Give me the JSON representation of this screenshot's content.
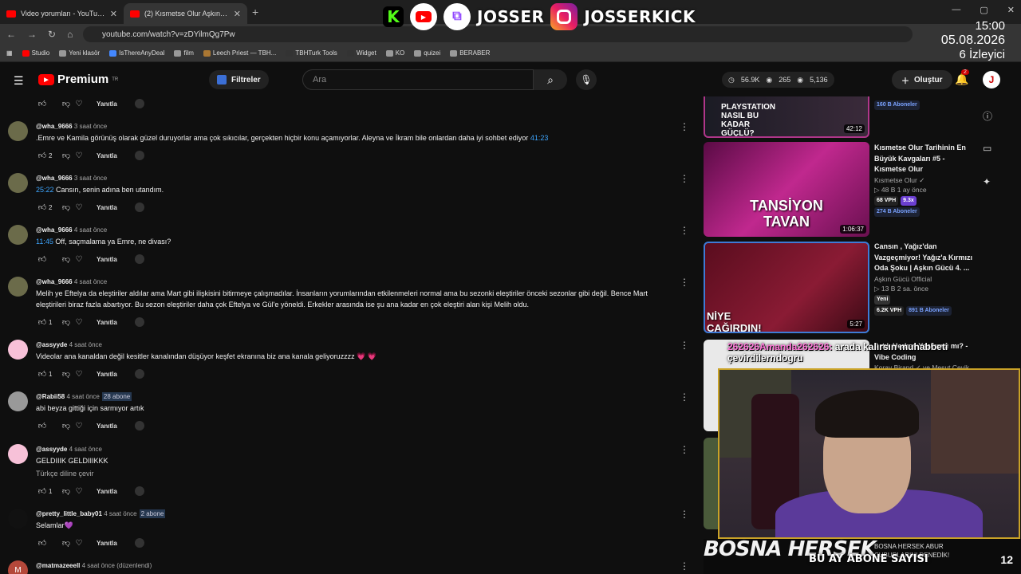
{
  "browser": {
    "tabs": [
      {
        "title": "Video yorumları - YouTube Studio"
      },
      {
        "title": "(2) Kısmetse Olur Aşkın Gücü 5..."
      }
    ],
    "new_tab": "+",
    "url": "youtube.com/watch?v=zDYilmQg7Pw",
    "bookmarks": [
      "Studio",
      "Yeni klasör",
      "IsThereAnyDeal",
      "film",
      "Leech Priest — TBH...",
      "TBHTurk Tools",
      "Widget",
      "KO",
      "quizei",
      "BERABER"
    ]
  },
  "overlay": {
    "brand1": "JOSSER",
    "brand2": "JOSSERKICK",
    "time": "15:00",
    "date": "05.08.2026",
    "viewers": "6 İzleyici",
    "chat_user": "262626Amanda262626:",
    "chat_msg": "arada kalırsın muhabbeti",
    "chat_msg2": "çevirdilerndogru",
    "bottom_big": "BOSNA HERSEK",
    "bottom_label": "BU AY ABONE SAYISI",
    "bottom_num": "12",
    "bottom_small": "BOSNA HERSEK ABUR CUBURLARINI DENEDİK!"
  },
  "youtube": {
    "premium": "Premium",
    "region": "TR",
    "filters": "Filtreler",
    "search_placeholder": "Ara",
    "stats": {
      "a": "56.9K",
      "b": "265",
      "c": "5,136"
    },
    "create": "Oluştur",
    "notif_count": "2",
    "avatar_letter": "J"
  },
  "comments": [
    {
      "user": "",
      "time": "",
      "text": "",
      "likes": "",
      "reply": "Yanıtla"
    },
    {
      "user": "@wha_9666",
      "time": "3 saat önce",
      "text": ".Emre ve Kamila görünüş olarak güzel duruyorlar ama çok sıkıcılar, gerçekten hiçbir konu açamıyorlar. Aleyna ve İkram bile onlardan daha iyi sohbet ediyor",
      "ts": "41:23",
      "likes": "2",
      "reply": "Yanıtla"
    },
    {
      "user": "@wha_9666",
      "time": "3 saat önce",
      "ts": "25:22",
      "text": "Cansın, senin adına ben utandım.",
      "likes": "2",
      "reply": "Yanıtla"
    },
    {
      "user": "@wha_9666",
      "time": "4 saat önce",
      "ts": "11:45",
      "text": "Off, saçmalama ya Emre, ne divası?",
      "likes": "",
      "reply": "Yanıtla"
    },
    {
      "user": "@wha_9666",
      "time": "4 saat önce",
      "text": "Melih ye Eftelya da eleştiriler aldılar ama Mart gibi ilişkisini bitirmeye çalışmadılar. İnsanların yorumlarından etkilenmeleri normal ama bu sezonki eleştiriler önceki sezonlar gibi değil. Bence Mart eleştirileri biraz fazla abartıyor. Bu sezon eleştiriler daha çok Eftelya ve Gül'e yöneldi. Erkekler arasında ise şu ana kadar en çok eleştiri alan kişi Melih oldu.",
      "likes": "1",
      "reply": "Yanıtla"
    },
    {
      "user": "@assyyde",
      "time": "4 saat önce",
      "text": "Videolar ana kanaldan değil kesitler kanalından düşüyor keşfet ekranına biz ana kanala geliyoruzzzz 💗 💗",
      "likes": "1",
      "reply": "Yanıtla"
    },
    {
      "user": "@Rabii58",
      "time": "4 saat önce",
      "badge": "28 abone",
      "text": "abi beyza gittiği için sarmıyor artık",
      "likes": "",
      "reply": "Yanıtla"
    },
    {
      "user": "@assyyde",
      "time": "4 saat önce",
      "text": "GELDIIIK GELDIIIKKK",
      "translate": "Türkçe diline çevir",
      "likes": "1",
      "reply": "Yanıtla"
    },
    {
      "user": "@pretty_little_baby01",
      "time": "4 saat önce",
      "badge": "2 abone",
      "text": "Selamlar💜",
      "likes": "",
      "reply": "Yanıtla"
    },
    {
      "user": "@matmazeeell",
      "time": "4 saat önce (düzenlendi)",
      "text": "",
      "likes": "",
      "reply": ""
    }
  ],
  "sidebar": [
    {
      "title": "",
      "channel": "",
      "meta": "",
      "chip": "160 B Aboneler",
      "thumb_text": "PLAYSTATION NASIL BU KADAR GÜÇLÜ?",
      "duration": "42:12"
    },
    {
      "title": "Kısmetse Olur Tarihinin En Büyük Kavgaları #5 - Kısmetse Olur",
      "channel": "Kısmetse Olur ✓",
      "meta": "▷ 48 B  1 ay önce",
      "vph": "68 VPH",
      "x": "9.3x",
      "chip": "274 B Aboneler",
      "thumb_text": "TANSİYON TAVAN",
      "duration": "1:06:37"
    },
    {
      "title": "Cansın , Yağız'dan Vazgeçmiyor! Yağız'a Kırmızı Oda Şoku | Aşkın Gücü 4. ...",
      "channel": "Aşkın Gücü Official",
      "meta": "▷ 13 B  2 sa. önce",
      "new": "Yeni",
      "vph": "6.2K VPH",
      "chip": "891 B Aboneler",
      "thumb_text": "NİYE ÇAĞIRDIN!",
      "duration": "5:27"
    },
    {
      "title": "Artık Herkes Yazılımcı mı? - Vibe Coding",
      "channel": "Koray Birand ✓ ve Mesut Çevik",
      "meta": "",
      "thumb_text": "",
      "duration": ""
    }
  ],
  "colors": {
    "accent": "#3ea6ff",
    "bg": "#0f0f0f",
    "red": "#ff0000"
  }
}
